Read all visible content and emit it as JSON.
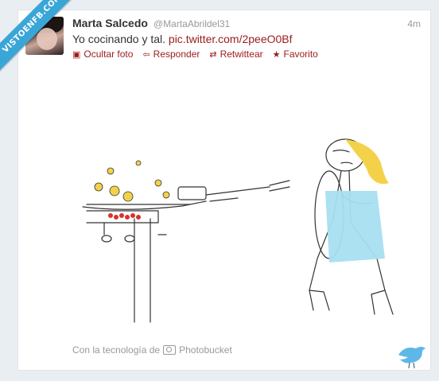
{
  "watermark": {
    "text": "VISTOENFB.COM"
  },
  "tweet": {
    "author_name": "Marta Salcedo",
    "author_handle": "@MartaAbrildel31",
    "time": "4m",
    "text": "Yo cocinando y tal.",
    "link": "pic.twitter.com/2peeO0Bf"
  },
  "actions": {
    "hide_photo": "Ocultar foto",
    "reply": "Responder",
    "retweet": "Retwittear",
    "favorite": "Favorito"
  },
  "credit": {
    "prefix": "Con la tecnología de",
    "provider": "Photobucket"
  },
  "colors": {
    "accent": "#9b1b1b",
    "ribbon": "#3aa6d8",
    "dress": "#a6dff0",
    "hair": "#f3d24a",
    "fire": "#d8322c",
    "bird": "#5fb7e8"
  },
  "icons": {
    "hide_photo": "photo-icon",
    "reply": "reply-arrow-icon",
    "retweet": "retweet-icon",
    "favorite": "star-icon",
    "credit": "camera-icon"
  }
}
